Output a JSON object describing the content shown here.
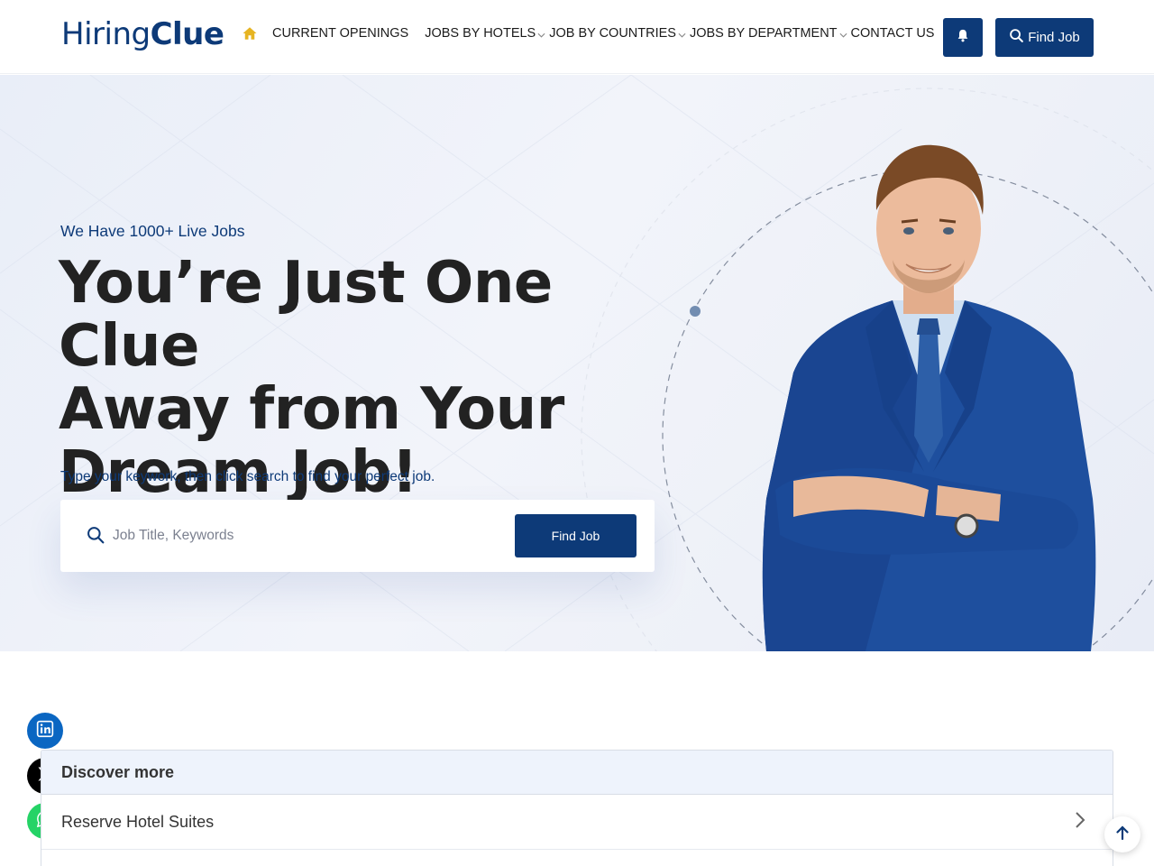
{
  "brand": {
    "logo_part1": "Hiring",
    "logo_part2": "Clue"
  },
  "nav": {
    "items": [
      {
        "label": "CURRENT OPENINGS",
        "dropdown": false
      },
      {
        "label": "JOBS BY HOTELS",
        "dropdown": true
      },
      {
        "label": "JOB BY COUNTRIES",
        "dropdown": true
      },
      {
        "label": "JOBS BY DEPARTMENT",
        "dropdown": true
      },
      {
        "label": "CONTACT US",
        "dropdown": false
      }
    ],
    "find_job_label": "Find Job"
  },
  "hero": {
    "subtitle": "We Have 1000+ Live Jobs",
    "title_line1": "You’re Just One Clue",
    "title_line2": "Away from Your",
    "title_line3": "Dream Job!",
    "hint": "Type your keywork, then click search to find your perfect job.",
    "search_placeholder": "Job Title, Keywords",
    "search_button": "Find Job"
  },
  "discover": {
    "heading": "Discover more",
    "items": [
      "Reserve Hotel Suites"
    ]
  },
  "colors": {
    "primary": "#0d3a78",
    "accent_home": "#e6b422",
    "linkedin": "#0a66c2",
    "x": "#000000",
    "whatsapp": "#25d366"
  },
  "icons": [
    "home-icon",
    "bell-icon",
    "search-icon",
    "chevron-down-icon",
    "linkedin-icon",
    "x-icon",
    "whatsapp-icon",
    "chevron-right-icon",
    "arrow-up-icon"
  ]
}
